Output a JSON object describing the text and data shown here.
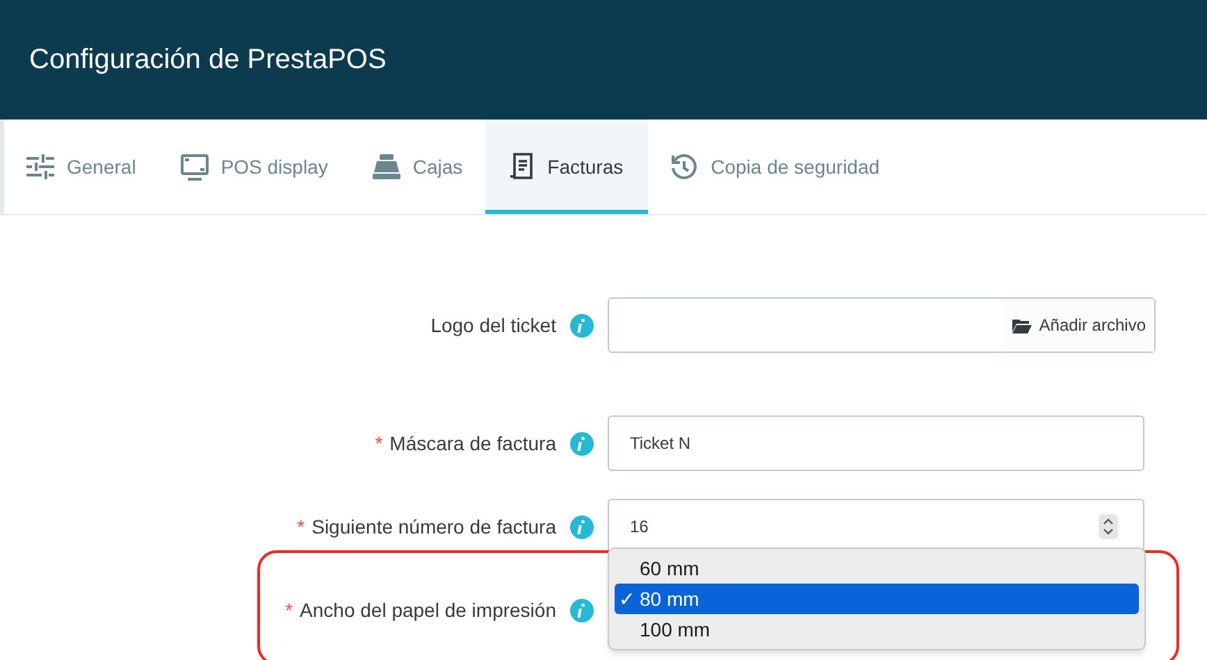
{
  "header": {
    "title": "Configuración de PrestaPOS"
  },
  "tabs": [
    {
      "label": "General",
      "kind": "sliders",
      "selected": false
    },
    {
      "label": "POS display",
      "kind": "display",
      "selected": false
    },
    {
      "label": "Cajas",
      "kind": "register",
      "selected": false
    },
    {
      "label": "Facturas",
      "kind": "receipt",
      "selected": true
    },
    {
      "label": "Copia de seguridad",
      "kind": "history",
      "selected": false
    }
  ],
  "fields": [
    {
      "kind": "file",
      "label": "Logo del ticket",
      "required": false,
      "button": "Añadir archivo"
    },
    {
      "kind": "text",
      "label": "Máscara de factura",
      "required": true,
      "value": "Ticket N"
    },
    {
      "kind": "number",
      "label": "Siguiente número de factura",
      "required": true,
      "value": "16"
    },
    {
      "kind": "select",
      "label": "Ancho del papel de impresión",
      "required": true,
      "highlighted": true,
      "options": [
        {
          "label": "60 mm",
          "selected": false
        },
        {
          "label": "80 mm",
          "selected": true
        },
        {
          "label": "100 mm",
          "selected": false
        }
      ]
    }
  ],
  "required_mark": "*",
  "check_mark": "✓"
}
